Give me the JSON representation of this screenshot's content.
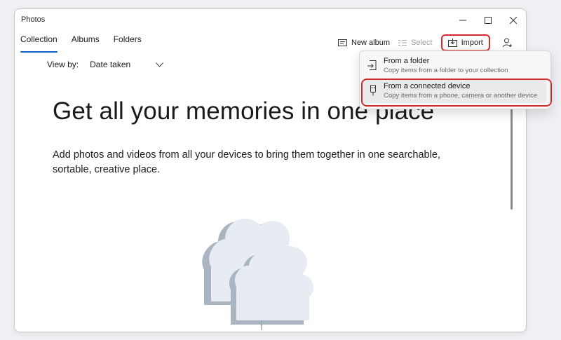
{
  "window": {
    "title": "Photos"
  },
  "tabs": [
    {
      "label": "Collection",
      "active": true
    },
    {
      "label": "Albums",
      "active": false
    },
    {
      "label": "Folders",
      "active": false
    }
  ],
  "toolbar": {
    "new_album": "New album",
    "select": "Select",
    "import": "Import",
    "icons": [
      "new-album-icon",
      "select-icon",
      "import-icon",
      "add-person-icon",
      "more-icon"
    ]
  },
  "view_by": {
    "label": "View by:",
    "value": "Date taken"
  },
  "main": {
    "headline": "Get all your memories in one place",
    "subtext": "Add photos and videos from all your devices to bring them together in one searchable, sortable, creative place."
  },
  "import_menu": {
    "items": [
      {
        "title": "From a folder",
        "description": "Copy items from a folder to your collection",
        "icon": "folder-import-icon"
      },
      {
        "title": "From a connected device",
        "description": "Copy items from a phone, camera or another device",
        "icon": "usb-device-icon"
      }
    ]
  },
  "colors": {
    "accent": "#0a62bf",
    "highlight_ring": "#d32a2a",
    "cloud_front": "#e6ecf2",
    "cloud_side": "#a9b6c2"
  }
}
